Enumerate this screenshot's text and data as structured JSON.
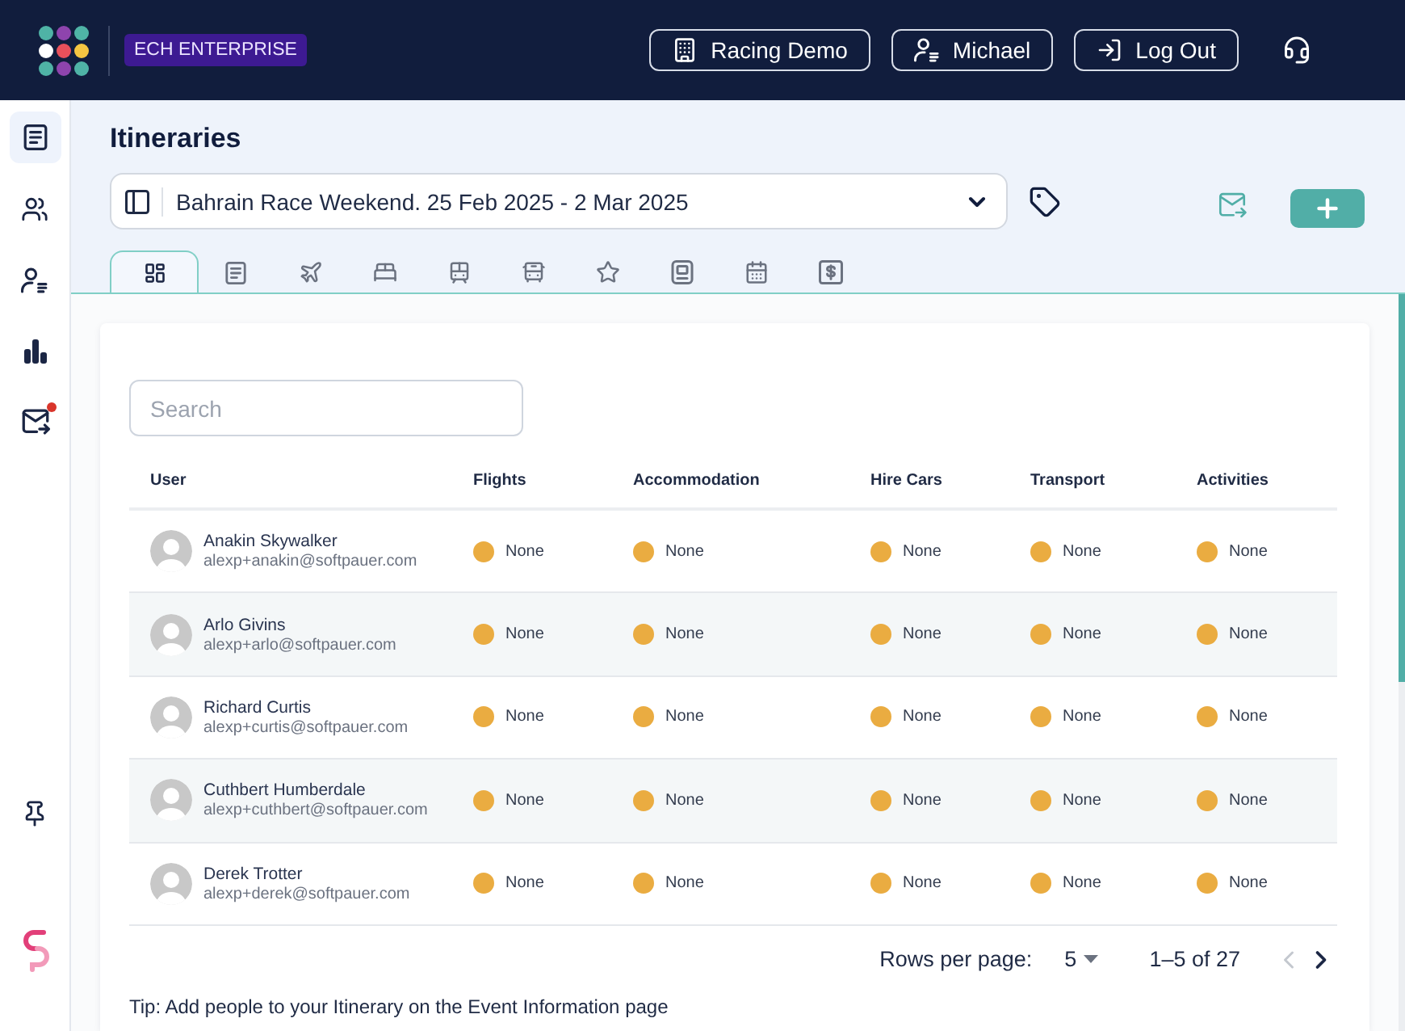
{
  "header": {
    "badge": "ECH ENTERPRISE",
    "buttons": [
      {
        "kind": "company",
        "label": "Racing Demo"
      },
      {
        "kind": "user",
        "label": "Michael"
      },
      {
        "kind": "logout",
        "label": "Log Out"
      }
    ]
  },
  "sidebar": {
    "items": [
      {
        "kind": "itineraries",
        "selected": true,
        "notification": false
      },
      {
        "kind": "people",
        "selected": false,
        "notification": false
      },
      {
        "kind": "users",
        "selected": false,
        "notification": false
      },
      {
        "kind": "reports",
        "selected": false,
        "notification": false
      },
      {
        "kind": "messages",
        "selected": false,
        "notification": true
      }
    ]
  },
  "page": {
    "title": "Itineraries",
    "event_select": {
      "value": "Bahrain Race Weekend. 25 Feb 2025 - 2 Mar 2025"
    }
  },
  "tabs": [
    {
      "kind": "overview",
      "selected": true
    },
    {
      "kind": "notes",
      "selected": false
    },
    {
      "kind": "flights",
      "selected": false
    },
    {
      "kind": "accommodation",
      "selected": false
    },
    {
      "kind": "trains",
      "selected": false
    },
    {
      "kind": "buses",
      "selected": false
    },
    {
      "kind": "activities",
      "selected": false
    },
    {
      "kind": "documents",
      "selected": false
    },
    {
      "kind": "calendar",
      "selected": false
    },
    {
      "kind": "costs",
      "selected": false
    }
  ],
  "search": {
    "placeholder": "Search"
  },
  "table": {
    "columns": [
      "User",
      "Flights",
      "Accommodation",
      "Hire Cars",
      "Transport",
      "Activities"
    ],
    "rows": [
      {
        "cells": [
          {
            "kind": "user",
            "name": "Anakin Skywalker",
            "email": "alexp+anakin@softpauer.com"
          },
          {
            "kind": "status",
            "status": "None",
            "color": "#eaac41"
          },
          {
            "kind": "status",
            "status": "None",
            "color": "#eaac41"
          },
          {
            "kind": "status",
            "status": "None",
            "color": "#eaac41"
          },
          {
            "kind": "status",
            "status": "None",
            "color": "#eaac41"
          },
          {
            "kind": "status",
            "status": "None",
            "color": "#eaac41"
          }
        ]
      },
      {
        "cells": [
          {
            "kind": "user",
            "name": "Arlo Givins",
            "email": "alexp+arlo@softpauer.com"
          },
          {
            "kind": "status",
            "status": "None",
            "color": "#eaac41"
          },
          {
            "kind": "status",
            "status": "None",
            "color": "#eaac41"
          },
          {
            "kind": "status",
            "status": "None",
            "color": "#eaac41"
          },
          {
            "kind": "status",
            "status": "None",
            "color": "#eaac41"
          },
          {
            "kind": "status",
            "status": "None",
            "color": "#eaac41"
          }
        ]
      },
      {
        "cells": [
          {
            "kind": "user",
            "name": "Richard Curtis",
            "email": "alexp+curtis@softpauer.com"
          },
          {
            "kind": "status",
            "status": "None",
            "color": "#eaac41"
          },
          {
            "kind": "status",
            "status": "None",
            "color": "#eaac41"
          },
          {
            "kind": "status",
            "status": "None",
            "color": "#eaac41"
          },
          {
            "kind": "status",
            "status": "None",
            "color": "#eaac41"
          },
          {
            "kind": "status",
            "status": "None",
            "color": "#eaac41"
          }
        ]
      },
      {
        "cells": [
          {
            "kind": "user",
            "name": "Cuthbert Humberdale",
            "email": "alexp+cuthbert@softpauer.com"
          },
          {
            "kind": "status",
            "status": "None",
            "color": "#eaac41"
          },
          {
            "kind": "status",
            "status": "None",
            "color": "#eaac41"
          },
          {
            "kind": "status",
            "status": "None",
            "color": "#eaac41"
          },
          {
            "kind": "status",
            "status": "None",
            "color": "#eaac41"
          },
          {
            "kind": "status",
            "status": "None",
            "color": "#eaac41"
          }
        ]
      },
      {
        "cells": [
          {
            "kind": "user",
            "name": "Derek Trotter",
            "email": "alexp+derek@softpauer.com"
          },
          {
            "kind": "status",
            "status": "None",
            "color": "#eaac41"
          },
          {
            "kind": "status",
            "status": "None",
            "color": "#eaac41"
          },
          {
            "kind": "status",
            "status": "None",
            "color": "#eaac41"
          },
          {
            "kind": "status",
            "status": "None",
            "color": "#eaac41"
          },
          {
            "kind": "status",
            "status": "None",
            "color": "#eaac41"
          }
        ]
      }
    ]
  },
  "pagination": {
    "rows_per_page_label": "Rows per page:",
    "rows_per_page": "5",
    "range": "1–5 of 27",
    "prev_disabled": true,
    "next_disabled": false
  },
  "tip": "Tip: Add people to your Itinerary on the Event Information page"
}
